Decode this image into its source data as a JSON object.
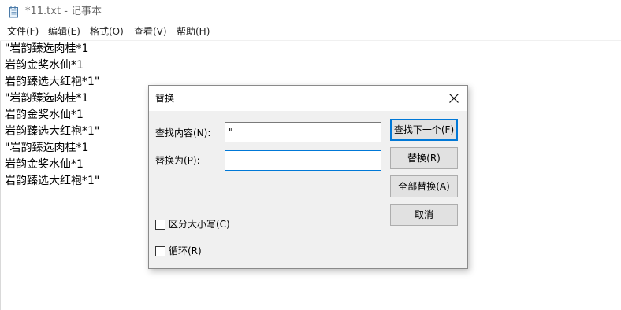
{
  "window": {
    "title": "*11.txt - 记事本",
    "app_icon": "notepad-icon"
  },
  "menu": [
    {
      "label": "文件(F)"
    },
    {
      "label": "编辑(E)"
    },
    {
      "label": "格式(O)"
    },
    {
      "label": "查看(V)"
    },
    {
      "label": "帮助(H)"
    }
  ],
  "editor": {
    "lines": [
      "\"岩韵臻选肉桂*1",
      "岩韵金奖水仙*1",
      "岩韵臻选大红袍*1\"",
      "\"岩韵臻选肉桂*1",
      "岩韵金奖水仙*1",
      "岩韵臻选大红袍*1\"",
      "\"岩韵臻选肉桂*1",
      "岩韵金奖水仙*1",
      "岩韵臻选大红袍*1\""
    ]
  },
  "dialog": {
    "title": "替换",
    "close_icon": "close-icon",
    "find_label": "查找内容(N):",
    "find_value": "\"",
    "replace_label": "替换为(P):",
    "replace_value": "",
    "find_next_button": "查找下一个(F)",
    "replace_button": "替换(R)",
    "replace_all_button": "全部替换(A)",
    "cancel_button": "取消",
    "match_case": {
      "label": "区分大小写(C)",
      "checked": false
    },
    "wrap_around": {
      "label": "循环(R)",
      "checked": false
    }
  },
  "colors": {
    "accent": "#0078d7",
    "dialog_bg": "#f0f0f0",
    "button_bg": "#e1e1e1"
  }
}
